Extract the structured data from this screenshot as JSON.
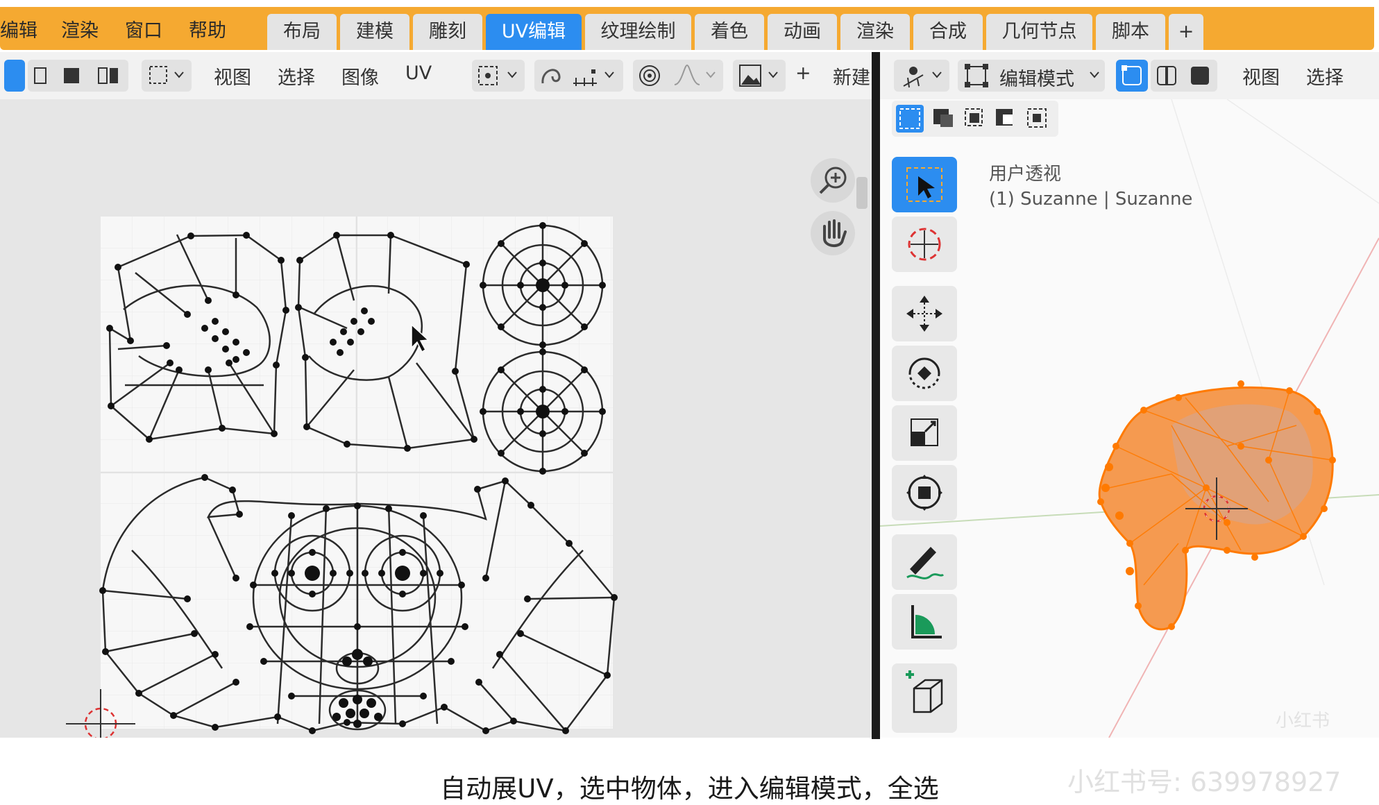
{
  "menu": {
    "items": [
      "编辑",
      "渲染",
      "窗口",
      "帮助"
    ]
  },
  "workspace_tabs": [
    {
      "label": "布局",
      "active": false
    },
    {
      "label": "建模",
      "active": false
    },
    {
      "label": "雕刻",
      "active": false
    },
    {
      "label": "UV编辑",
      "active": true
    },
    {
      "label": "纹理绘制",
      "active": false
    },
    {
      "label": "着色",
      "active": false
    },
    {
      "label": "动画",
      "active": false
    },
    {
      "label": "渲染",
      "active": false
    },
    {
      "label": "合成",
      "active": false
    },
    {
      "label": "几何节点",
      "active": false
    },
    {
      "label": "脚本",
      "active": false
    }
  ],
  "add_tab_label": "+",
  "uv_header": {
    "menus": [
      "视图",
      "选择",
      "图像",
      "UV"
    ],
    "new_label": "新建",
    "plus_label": "+"
  },
  "viewport_header": {
    "mode": "编辑模式",
    "menus": [
      "视图",
      "选择"
    ]
  },
  "viewport": {
    "view_label": "用户透视",
    "object_label": "(1) Suzanne | Suzanne"
  },
  "caption": "自动展UV，选中物体，进入编辑模式，全选",
  "watermark": "小红书号: 639978927",
  "watermark_logo": "小红书",
  "colors": {
    "accent": "#2c8df0",
    "topbar": "#f5a931",
    "mesh_selected": "#ff7a00"
  },
  "icons": {
    "uv_zoom": "zoom-in-icon",
    "uv_pan": "hand-icon",
    "toolbar": [
      "select-box-icon",
      "cursor-icon",
      "move-icon",
      "rotate-icon",
      "scale-icon",
      "transform-icon",
      "annotate-icon",
      "measure-icon",
      "add-cube-icon"
    ]
  }
}
